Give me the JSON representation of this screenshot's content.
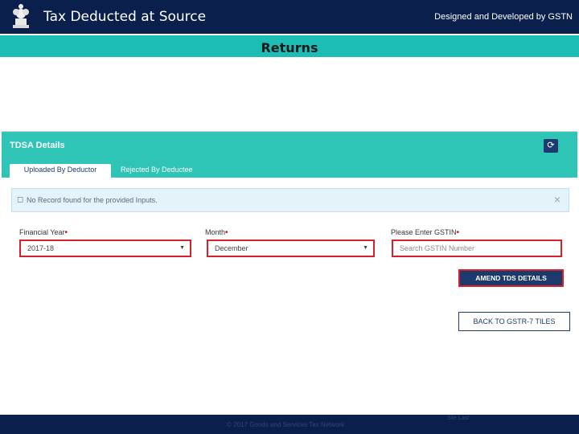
{
  "header": {
    "title": "Tax Deducted at Source",
    "credit": "Designed and Developed by GSTN",
    "emblem_icon": "state-emblem-icon"
  },
  "band": {
    "title": "Returns"
  },
  "panel": {
    "title": "TDSA Details",
    "refresh_icon": "refresh-icon",
    "tabs": [
      {
        "label": "Uploaded By Deductor",
        "active": true
      },
      {
        "label": "Rejected By Deductee",
        "active": false
      }
    ],
    "alert": {
      "icon": "info-icon",
      "text": "No Record found for the provided Inputs.",
      "close": "×"
    },
    "fields": {
      "financial_year": {
        "label": "Financial Year",
        "required": "•",
        "value": "2017-18"
      },
      "month": {
        "label": "Month",
        "required": "•",
        "value": "December"
      },
      "gstin": {
        "label": "Please Enter GSTIN",
        "required": "•",
        "placeholder": "Search GSTIN Number"
      }
    },
    "buttons": {
      "amend": "AMEND TDS DETAILS",
      "back": "BACK TO GSTR-7 TILES"
    }
  },
  "footer": {
    "copyright": "© 2017 Goods and Services Tax Network",
    "page": "Site Last"
  },
  "colors": {
    "header_bg": "#0b1f4d",
    "band_bg": "#1cbdb5",
    "panel_bg": "#2ec4b6",
    "highlight": "#d6202a",
    "button_bg": "#1d3a6e"
  }
}
